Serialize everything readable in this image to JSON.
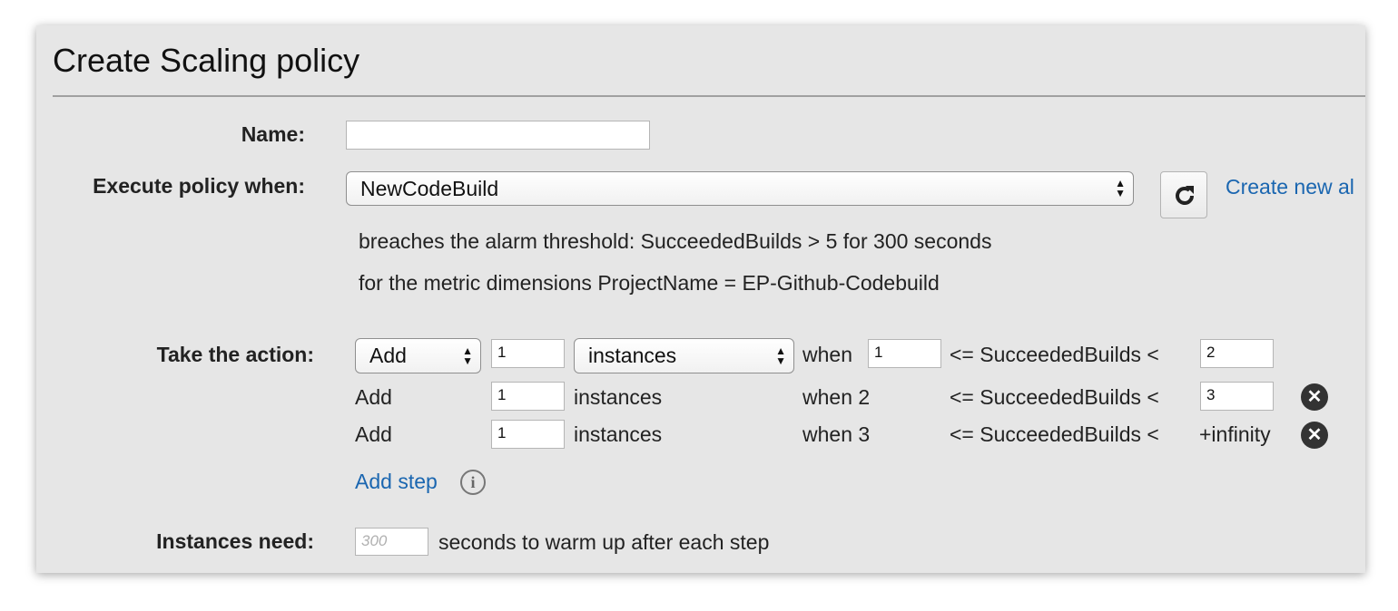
{
  "dialog": {
    "title": "Create Scaling policy"
  },
  "form": {
    "name_label": "Name:",
    "name_value": "",
    "execute_label": "Execute policy when:",
    "alarm_selected": "NewCodeBuild",
    "create_alarm_link": "Create new al",
    "alarm_details": {
      "threshold_text": "breaches the alarm threshold: SucceededBuilds > 5 for 300 seconds",
      "dimensions_text": "for the metric dimensions ProjectName = EP-Github-Codebuild"
    },
    "action_label": "Take the action:",
    "steps": [
      {
        "action": "Add",
        "amount": "1",
        "unit": "instances",
        "when_label": "when",
        "lower": "1",
        "metric_text": "<= SucceededBuilds <",
        "upper": "2"
      },
      {
        "action": "Add",
        "amount": "1",
        "unit": "instances",
        "when_label": "when 2",
        "metric_text": "<= SucceededBuilds <",
        "upper": "3"
      },
      {
        "action": "Add",
        "amount": "1",
        "unit": "instances",
        "when_label": "when 3",
        "metric_text": "<= SucceededBuilds <",
        "upper": "+infinity"
      }
    ],
    "add_step_link": "Add step",
    "instances_label": "Instances need:",
    "warmup_placeholder": "300",
    "warmup_suffix": "seconds to warm up after each step"
  },
  "icons": {
    "refresh": "refresh-icon",
    "remove": "close-circle-icon",
    "info": "info-icon",
    "select_arrows": "up-down-arrows-icon"
  }
}
